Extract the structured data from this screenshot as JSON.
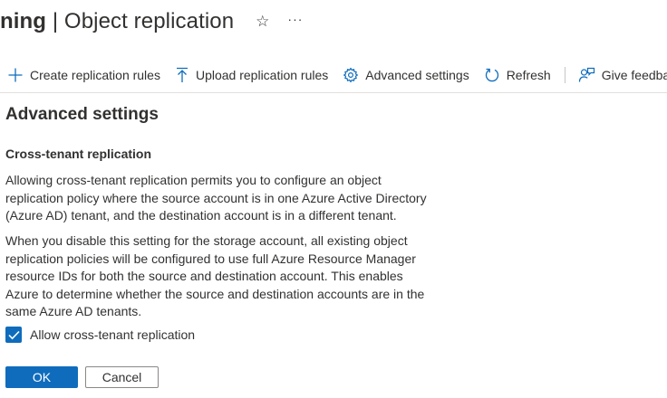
{
  "header": {
    "title_bold": "ning",
    "title_rest": " | Object replication",
    "favorite_icon": "star-icon",
    "more_icon": "ellipsis-icon"
  },
  "toolbar": {
    "accent_color": "#0f6cbd",
    "items": [
      {
        "label": "Create replication rules",
        "icon": "plus-icon"
      },
      {
        "label": "Upload replication rules",
        "icon": "upload-icon"
      },
      {
        "label": "Advanced settings",
        "icon": "gear-icon"
      },
      {
        "label": "Refresh",
        "icon": "refresh-icon"
      },
      {
        "label": "Give feedback",
        "icon": "feedback-icon"
      }
    ]
  },
  "panel": {
    "title": "Advanced settings",
    "section_title": "Cross-tenant replication",
    "paragraph1": "Allowing cross-tenant replication permits you to configure an object replication policy where the source account is in one Azure Active Directory (Azure AD) tenant, and the destination account is in a different tenant.",
    "paragraph2": "When you disable this setting for the storage account, all existing object replication policies will be configured to use full Azure Resource Manager resource IDs for both the source and destination account. This enables Azure to determine whether the source and destination accounts are in the same Azure AD tenants.",
    "checkbox": {
      "label": "Allow cross-tenant replication",
      "checked": true
    },
    "ok_label": "OK",
    "cancel_label": "Cancel"
  }
}
